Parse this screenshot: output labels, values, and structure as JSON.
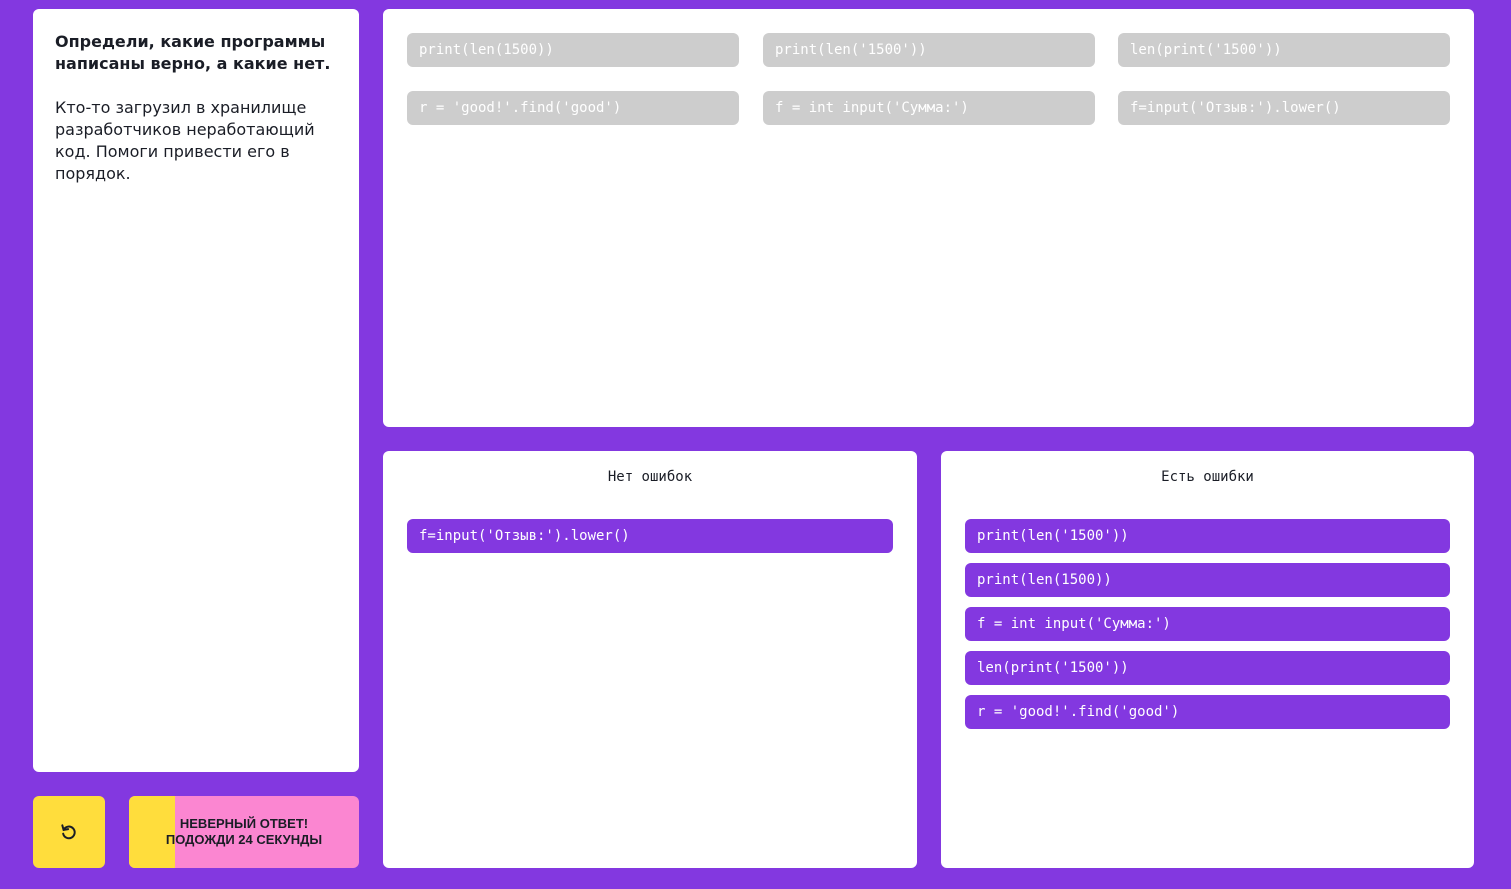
{
  "task": {
    "title": "Определи, какие программы написаны верно, а какие нет.",
    "description": "Кто-то загрузил в хранилище разработчиков неработающий код. Помоги привести его в порядок."
  },
  "source_items": [
    "print(len(1500))",
    "print(len('1500'))",
    "len(print('1500'))",
    "r = 'good!'.find('good')",
    "f = int input('Сумма:')",
    "f=input('Отзыв:').lower()"
  ],
  "buckets": {
    "no_errors": {
      "title": "Нет ошибок",
      "items": [
        "f=input('Отзыв:').lower()"
      ]
    },
    "has_errors": {
      "title": "Есть ошибки",
      "items": [
        "print(len('1500'))",
        "print(len(1500))",
        "f = int input('Сумма:')",
        "len(print('1500'))",
        "r = 'good!'.find('good')"
      ]
    }
  },
  "status": {
    "line1": "НЕВЕРНЫЙ ОТВЕТ!",
    "line2": "ПОДОЖДИ 24 СЕКУНДЫ",
    "progress": 0.2
  },
  "icons": {
    "reset": "reset-icon"
  },
  "colors": {
    "background": "#8338e0",
    "chip_gray": "#cdcdcd",
    "chip_purple": "#8338e0",
    "button_yellow": "#ffdd3c",
    "status_pink": "#fb86d1"
  }
}
